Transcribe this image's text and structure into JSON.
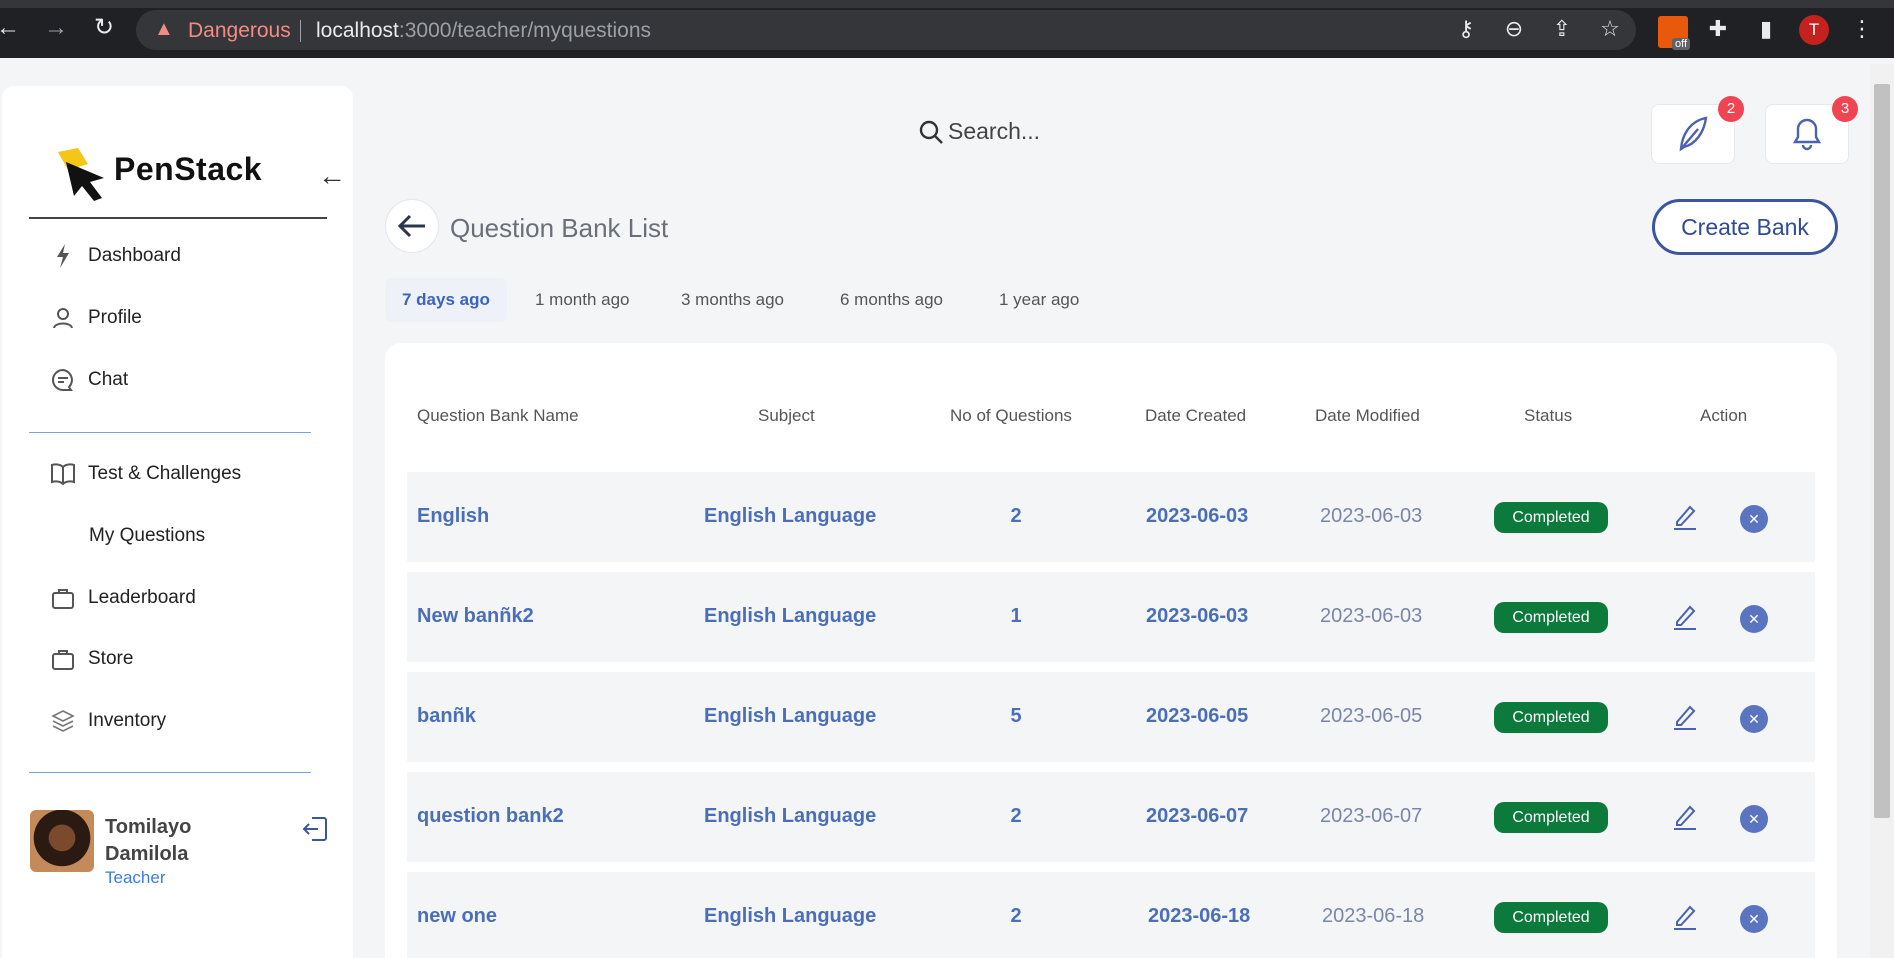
{
  "browser": {
    "security_label": "Dangerous",
    "url_host": "localhost",
    "url_path": ":3000/teacher/myquestions",
    "profile_initial": "T",
    "extension_off_label": "off"
  },
  "sidebar": {
    "brand": "PenStack",
    "items": [
      {
        "label": "Dashboard",
        "icon": "bolt-icon"
      },
      {
        "label": "Profile",
        "icon": "user-icon"
      },
      {
        "label": "Chat",
        "icon": "chat-icon"
      },
      {
        "label": "Test & Challenges",
        "icon": "book-icon"
      },
      {
        "label": "My Questions",
        "icon": ""
      },
      {
        "label": "Leaderboard",
        "icon": "bag-icon"
      },
      {
        "label": "Store",
        "icon": "bag-icon"
      },
      {
        "label": "Inventory",
        "icon": "layers-icon"
      }
    ],
    "user": {
      "name": "Tomilayo Damilola",
      "role": "Teacher"
    }
  },
  "header": {
    "search_placeholder": "Search...",
    "messages_badge": "2",
    "notifications_badge": "3"
  },
  "main": {
    "title": "Question Bank List",
    "create_label": "Create Bank",
    "tabs": [
      "7 days ago",
      "1 month ago",
      "3 months ago",
      "6 months ago",
      "1 year ago"
    ],
    "active_tab": 0,
    "columns": [
      "Question Bank Name",
      "Subject",
      "No of Questions",
      "Date Created",
      "Date Modified",
      "Status",
      "Action"
    ],
    "rows": [
      {
        "name": "English",
        "subject": "English Language",
        "count": "2",
        "created": "2023-06-03",
        "modified": "2023-06-03",
        "status": "Completed"
      },
      {
        "name": "New banñk2",
        "subject": "English Language",
        "count": "1",
        "created": "2023-06-03",
        "modified": "2023-06-03",
        "status": "Completed"
      },
      {
        "name": "banñk",
        "subject": "English Language",
        "count": "5",
        "created": "2023-06-05",
        "modified": "2023-06-05",
        "status": "Completed"
      },
      {
        "name": "question bank2",
        "subject": "English Language",
        "count": "2",
        "created": "2023-06-07",
        "modified": "2023-06-07",
        "status": "Completed"
      },
      {
        "name": "new one",
        "subject": "English Language",
        "count": "2",
        "created": "2023-06-18",
        "modified": "2023-06-18",
        "status": "Completed"
      }
    ]
  },
  "colors": {
    "accent": "#3c55a0",
    "status_completed": "#0b7a3b",
    "badge": "#f04452"
  }
}
